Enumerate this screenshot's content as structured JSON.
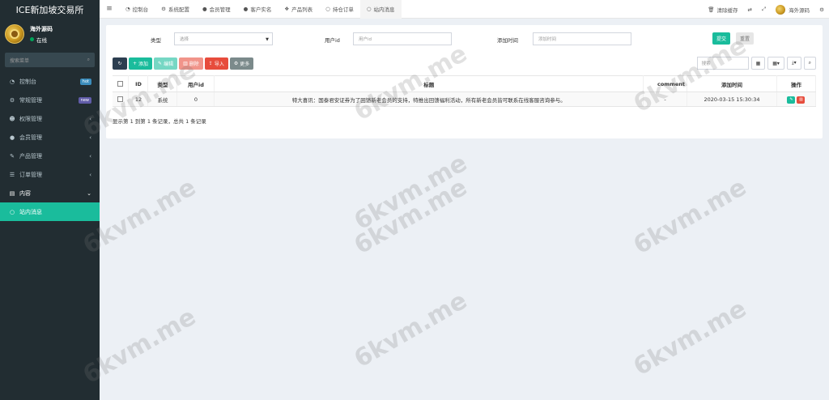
{
  "app": {
    "title": "ICE新加坡交易所",
    "user_name": "海外源码",
    "user_status": "在线",
    "search_placeholder": "搜索菜单"
  },
  "sidebar": {
    "items": [
      {
        "label": "控制台",
        "icon": "dashboard-icon",
        "badge": "hot"
      },
      {
        "label": "常规管理",
        "icon": "cogs-icon",
        "badge": "new"
      },
      {
        "label": "权限管理",
        "icon": "group-icon",
        "chevron": "‹"
      },
      {
        "label": "会员管理",
        "icon": "user-icon",
        "chevron": "‹"
      },
      {
        "label": "产品管理",
        "icon": "wrench-icon",
        "chevron": "‹"
      },
      {
        "label": "订单管理",
        "icon": "list-icon",
        "chevron": "‹"
      },
      {
        "label": "内容",
        "icon": "list-alt-icon",
        "chevron": "⌄"
      },
      {
        "label": "站内消息",
        "icon": "circle-icon"
      }
    ]
  },
  "topbar": {
    "tabs": [
      {
        "label": "控制台",
        "icon": "dashboard-icon"
      },
      {
        "label": "系统配置",
        "icon": "cog-icon"
      },
      {
        "label": "会员管理",
        "icon": "user-icon"
      },
      {
        "label": "客户实名",
        "icon": "user-icon"
      },
      {
        "label": "产品列表",
        "icon": "cubes-icon"
      },
      {
        "label": "持仓订单",
        "icon": "circle-icon"
      },
      {
        "label": "站内消息",
        "icon": "circle-icon"
      }
    ],
    "clear_cache": "清除缓存",
    "user_name": "海外源码"
  },
  "filters": {
    "type_label": "类型",
    "type_value": "选择",
    "userid_label": "用户id",
    "userid_placeholder": "用户id",
    "addtime_label": "添加时间",
    "addtime_placeholder": "添加时间",
    "submit_label": "提交",
    "reset_label": "重置"
  },
  "toolbar": {
    "add": "添加",
    "edit": "编辑",
    "delete": "删除",
    "import": "导入",
    "more": "更多",
    "search_placeholder": "搜索"
  },
  "table": {
    "headers": [
      "ID",
      "类型",
      "用户id",
      "标题",
      "comment",
      "添加时间",
      "操作"
    ],
    "rows": [
      {
        "id": "12",
        "type": "系统",
        "userid": "0",
        "title": "特大喜讯：国泰君安证券为了回馈新老会员的支持，特推出回馈福利活动，所有新老会员皆可联系在线客服咨询参与。",
        "comment": "-",
        "addtime": "2020-03-15 15:30:34"
      }
    ]
  },
  "pager": {
    "text": "显示第 1 到第 1 条记录，总共 1 条记录"
  },
  "watermark": {
    "text": "6kvm.me"
  }
}
